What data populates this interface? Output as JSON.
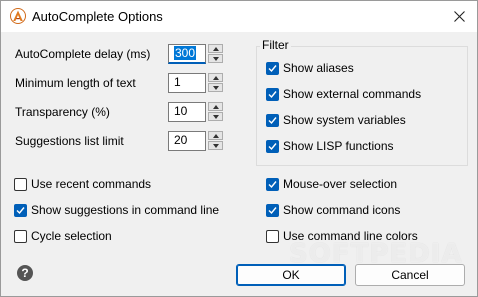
{
  "window": {
    "title": "AutoComplete Options",
    "accent_color": "#005fb8"
  },
  "settings": [
    {
      "label": "AutoComplete delay (ms)",
      "value": "300",
      "selected": true
    },
    {
      "label": "Minimum length of text",
      "value": "1",
      "selected": false
    },
    {
      "label": "Transparency (%)",
      "value": "10",
      "selected": false
    },
    {
      "label": "Suggestions list limit",
      "value": "20",
      "selected": false
    }
  ],
  "filter": {
    "title": "Filter",
    "options": [
      {
        "label": "Show aliases",
        "checked": true
      },
      {
        "label": "Show external commands",
        "checked": true
      },
      {
        "label": "Show system variables",
        "checked": true
      },
      {
        "label": "Show LISP functions",
        "checked": true
      }
    ]
  },
  "left_options": [
    {
      "label": "Use recent commands",
      "checked": false
    },
    {
      "label": "Show suggestions in command line",
      "checked": true
    },
    {
      "label": "Cycle selection",
      "checked": false
    }
  ],
  "right_options": [
    {
      "label": "Mouse-over selection",
      "checked": true
    },
    {
      "label": "Show command icons",
      "checked": true
    },
    {
      "label": "Use command line colors",
      "checked": false
    }
  ],
  "buttons": {
    "ok": "OK",
    "cancel": "Cancel",
    "help_glyph": "?"
  },
  "watermark": "SOFTPEDIA",
  "icons": {
    "app": "autocomplete-app-icon",
    "close": "close-icon",
    "help": "help-icon"
  }
}
